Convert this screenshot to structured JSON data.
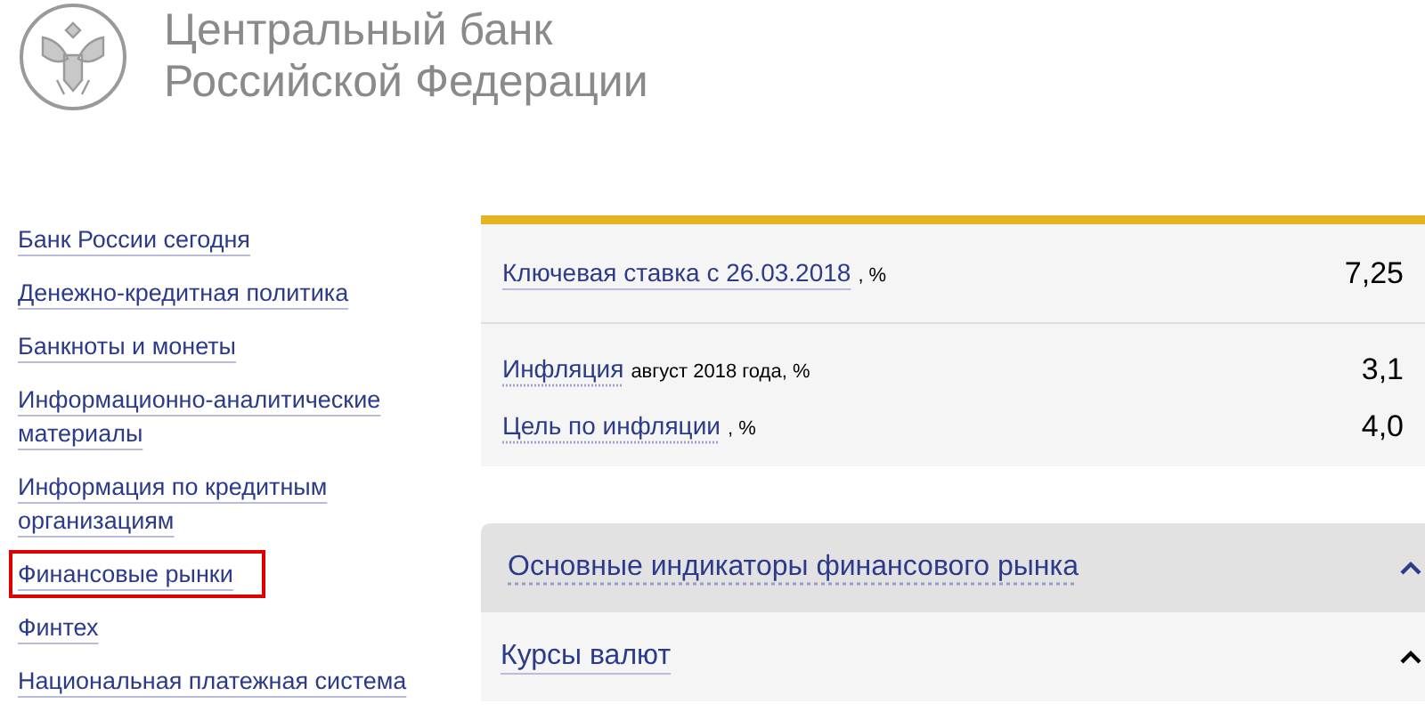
{
  "header": {
    "title_line_1": "Центральный банк",
    "title_line_2": "Российской Федерации"
  },
  "sidebar": {
    "items": [
      {
        "label": "Банк России сегодня",
        "highlighted": false
      },
      {
        "label": "Денежно-кредитная политика",
        "highlighted": false
      },
      {
        "label": "Банкноты и монеты",
        "highlighted": false
      },
      {
        "label": "Информационно-аналитические материалы",
        "highlighted": false
      },
      {
        "label": "Информация по кредитным организациям",
        "highlighted": false
      },
      {
        "label": "Финансовые рынки",
        "highlighted": true
      },
      {
        "label": "Финтех",
        "highlighted": false
      },
      {
        "label": "Национальная платежная система",
        "highlighted": false
      }
    ]
  },
  "key_rate": {
    "label": "Ключевая ставка с 26.03.2018",
    "unit": ", %",
    "value": "7,25"
  },
  "inflation": [
    {
      "label": "Инфляция",
      "note": "август 2018 года, %",
      "value": "3,1"
    },
    {
      "label": "Цель по инфляции",
      "note": ", %",
      "value": "4,0"
    }
  ],
  "accordion": {
    "title": "Основные индикаторы финансового рынка",
    "expanded": true,
    "items": [
      {
        "label": "Курсы валют",
        "expanded": true
      }
    ]
  }
}
